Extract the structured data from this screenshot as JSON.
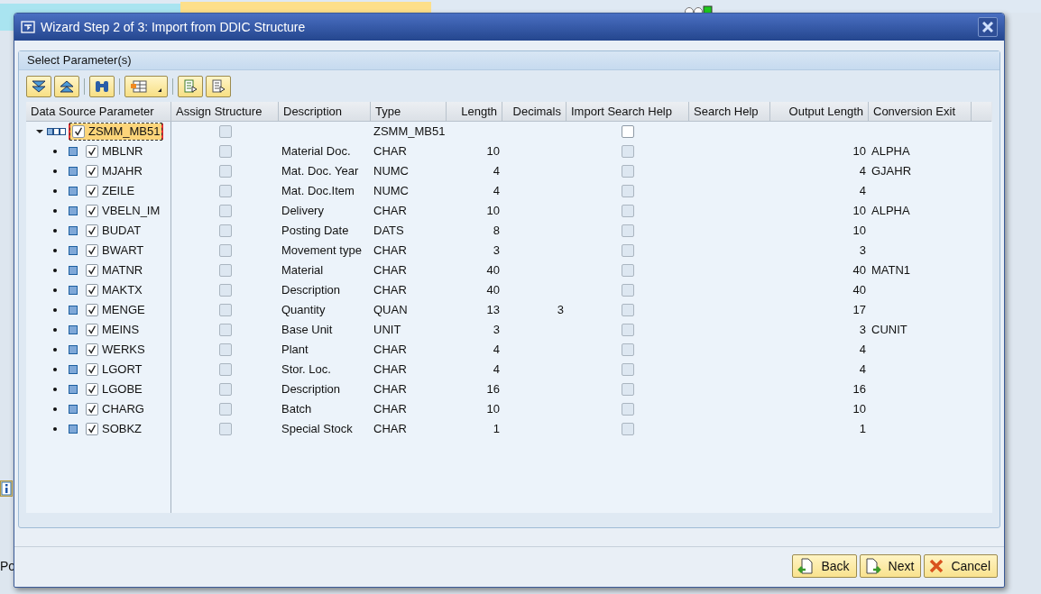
{
  "background": {
    "left_labels": [
      "Po"
    ]
  },
  "dialog": {
    "title": "Wizard Step 2 of 3: Import from DDIC Structure",
    "group_title": "Select Parameter(s)",
    "columns": [
      "Data Source Parameter",
      "Assign Structure",
      "Description",
      "Type",
      "Length",
      "Decimals",
      "Import Search Help",
      "Search Help",
      "Output Length",
      "Conversion Exit"
    ],
    "tree": [
      {
        "name": "ZSMM_MB51",
        "checked": true,
        "selected": true,
        "expanded": true,
        "assign_structure": false,
        "assign_structure_disabled": true,
        "type": "ZSMM_MB51",
        "import_search_help": false,
        "import_search_help_disabled": false,
        "children": [
          {
            "name": "MBLNR",
            "checked": true,
            "selected": false,
            "assign_structure": false,
            "assign_structure_disabled": true,
            "description": "Material Doc.",
            "type": "CHAR",
            "length": "10",
            "output_length": "10",
            "conversion_exit": "ALPHA",
            "import_search_help": false,
            "import_search_help_disabled": true
          },
          {
            "name": "MJAHR",
            "checked": true,
            "selected": false,
            "assign_structure": false,
            "assign_structure_disabled": true,
            "description": "Mat. Doc. Year",
            "type": "NUMC",
            "length": "4",
            "output_length": "4",
            "conversion_exit": "GJAHR",
            "import_search_help": false,
            "import_search_help_disabled": true
          },
          {
            "name": "ZEILE",
            "checked": true,
            "selected": false,
            "assign_structure": false,
            "assign_structure_disabled": true,
            "description": "Mat. Doc.Item",
            "type": "NUMC",
            "length": "4",
            "output_length": "4",
            "import_search_help": false,
            "import_search_help_disabled": true
          },
          {
            "name": "VBELN_IM",
            "checked": true,
            "selected": false,
            "assign_structure": false,
            "assign_structure_disabled": true,
            "description": "Delivery",
            "type": "CHAR",
            "length": "10",
            "output_length": "10",
            "conversion_exit": "ALPHA",
            "import_search_help": false,
            "import_search_help_disabled": true
          },
          {
            "name": "BUDAT",
            "checked": true,
            "selected": false,
            "assign_structure": false,
            "assign_structure_disabled": true,
            "description": "Posting Date",
            "type": "DATS",
            "length": "8",
            "output_length": "10",
            "import_search_help": false,
            "import_search_help_disabled": true
          },
          {
            "name": "BWART",
            "checked": true,
            "selected": false,
            "assign_structure": false,
            "assign_structure_disabled": true,
            "description": "Movement type",
            "type": "CHAR",
            "length": "3",
            "output_length": "3",
            "import_search_help": false,
            "import_search_help_disabled": true
          },
          {
            "name": "MATNR",
            "checked": true,
            "selected": false,
            "assign_structure": false,
            "assign_structure_disabled": true,
            "description": "Material",
            "type": "CHAR",
            "length": "40",
            "output_length": "40",
            "conversion_exit": "MATN1",
            "import_search_help": false,
            "import_search_help_disabled": true
          },
          {
            "name": "MAKTX",
            "checked": true,
            "selected": false,
            "assign_structure": false,
            "assign_structure_disabled": true,
            "description": "Description",
            "type": "CHAR",
            "length": "40",
            "output_length": "40",
            "import_search_help": false,
            "import_search_help_disabled": true
          },
          {
            "name": "MENGE",
            "checked": true,
            "selected": false,
            "assign_structure": false,
            "assign_structure_disabled": true,
            "description": "Quantity",
            "type": "QUAN",
            "length": "13",
            "decimals": "3",
            "output_length": "17",
            "import_search_help": false,
            "import_search_help_disabled": true
          },
          {
            "name": "MEINS",
            "checked": true,
            "selected": false,
            "assign_structure": false,
            "assign_structure_disabled": true,
            "description": "Base Unit",
            "type": "UNIT",
            "length": "3",
            "output_length": "3",
            "conversion_exit": "CUNIT",
            "import_search_help": false,
            "import_search_help_disabled": true
          },
          {
            "name": "WERKS",
            "checked": true,
            "selected": false,
            "assign_structure": false,
            "assign_structure_disabled": true,
            "description": "Plant",
            "type": "CHAR",
            "length": "4",
            "output_length": "4",
            "import_search_help": false,
            "import_search_help_disabled": true
          },
          {
            "name": "LGORT",
            "checked": true,
            "selected": false,
            "assign_structure": false,
            "assign_structure_disabled": true,
            "description": "Stor. Loc.",
            "type": "CHAR",
            "length": "4",
            "output_length": "4",
            "import_search_help": false,
            "import_search_help_disabled": true
          },
          {
            "name": "LGOBE",
            "checked": true,
            "selected": false,
            "assign_structure": false,
            "assign_structure_disabled": true,
            "description": "Description",
            "type": "CHAR",
            "length": "16",
            "output_length": "16",
            "import_search_help": false,
            "import_search_help_disabled": true
          },
          {
            "name": "CHARG",
            "checked": true,
            "selected": false,
            "assign_structure": false,
            "assign_structure_disabled": true,
            "description": "Batch",
            "type": "CHAR",
            "length": "10",
            "output_length": "10",
            "import_search_help": false,
            "import_search_help_disabled": true
          },
          {
            "name": "SOBKZ",
            "checked": true,
            "selected": false,
            "assign_structure": false,
            "assign_structure_disabled": true,
            "description": "Special Stock",
            "type": "CHAR",
            "length": "1",
            "output_length": "1",
            "import_search_help": false,
            "import_search_help_disabled": true
          }
        ]
      }
    ],
    "buttons": [
      {
        "label": "Back",
        "kind": "back"
      },
      {
        "label": "Next",
        "kind": "next"
      },
      {
        "label": "Cancel",
        "kind": "cancel"
      }
    ]
  }
}
